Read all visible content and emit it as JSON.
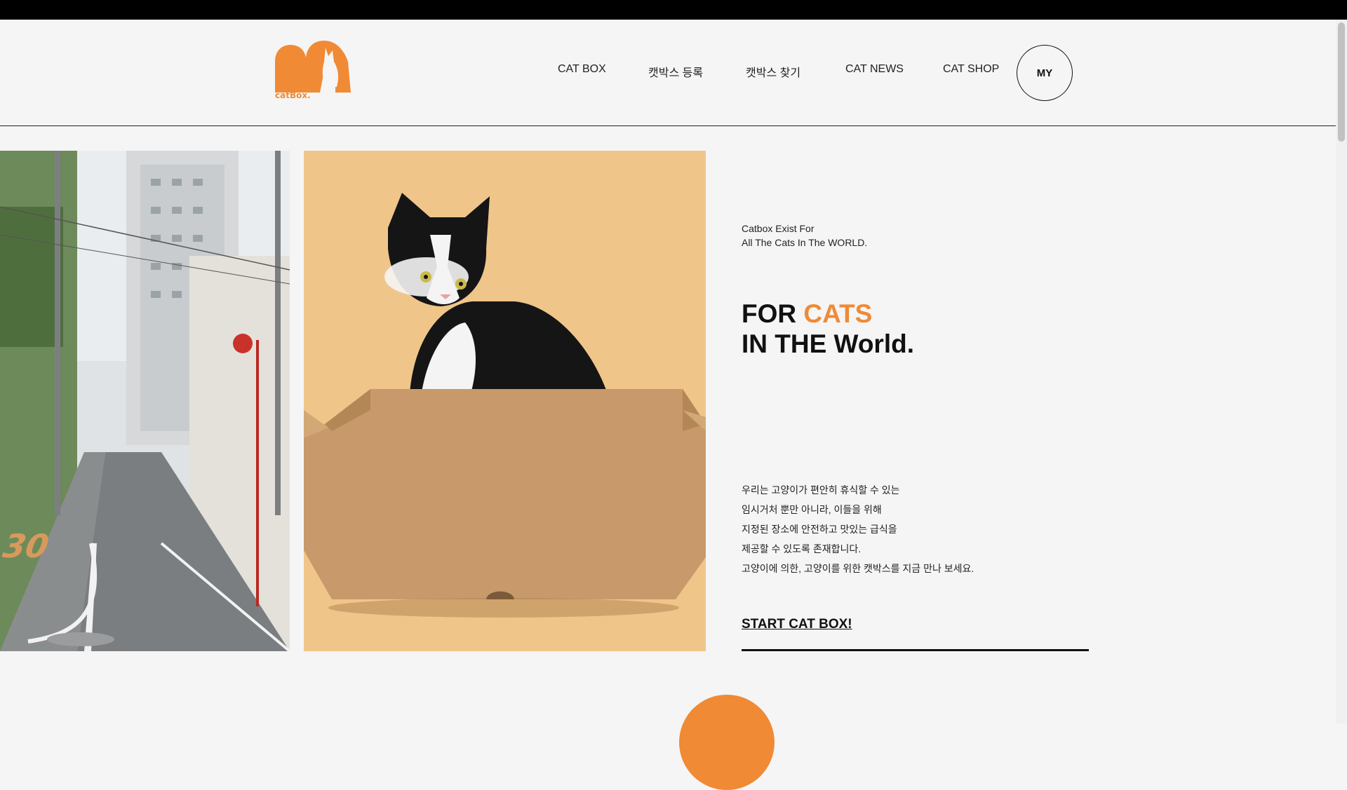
{
  "brand": {
    "logo_text": "catBox.",
    "accent_color": "#f08a35"
  },
  "nav": {
    "items": [
      {
        "label": "CAT BOX"
      },
      {
        "label": "캣박스 등록"
      },
      {
        "label": "캣박스 찾기"
      },
      {
        "label": "CAT NEWS"
      },
      {
        "label": "CAT SHOP"
      }
    ],
    "my_label": "MY"
  },
  "hero": {
    "tagline_line1": "Catbox Exist For",
    "tagline_line2": "All The Cats In The WORLD.",
    "headline_pre": "FOR ",
    "headline_accent": "CATS",
    "headline_line2": "IN THE World.",
    "desc": [
      "우리는 고양이가 편안히 휴식할 수 있는",
      "임시거처 뿐만 아니라, 이들을 위해",
      "지정된 장소에 안전하고 맛있는 급식을",
      "제공할 수 있도록 존재합니다.",
      "고양이에 의한, 고양이를 위한 캣박스를 지금 만나 보세요."
    ],
    "cta_label": "START CAT BOX!"
  },
  "images": {
    "street": "street-photo",
    "cat": "cat-in-box-photo"
  }
}
